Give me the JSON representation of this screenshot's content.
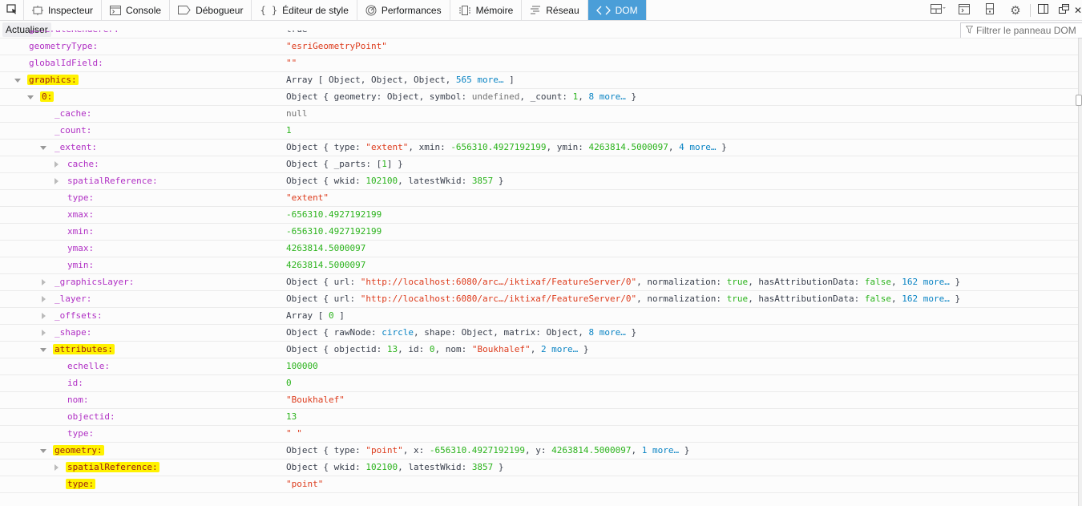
{
  "toolbar": {
    "tabs": [
      {
        "label": "Inspecteur",
        "icon": "inspector-icon",
        "active": false
      },
      {
        "label": "Console",
        "icon": "console-icon",
        "active": false
      },
      {
        "label": "Débogueur",
        "icon": "debugger-icon",
        "active": false
      },
      {
        "label": "Éditeur de style",
        "icon": "style-editor-icon",
        "active": false
      },
      {
        "label": "Performances",
        "icon": "performance-icon",
        "active": false
      },
      {
        "label": "Mémoire",
        "icon": "memory-icon",
        "active": false
      },
      {
        "label": "Réseau",
        "icon": "network-icon",
        "active": false
      },
      {
        "label": "DOM",
        "icon": "dom-icon",
        "active": true
      }
    ],
    "right_icons": [
      "layout-dropdown-icon",
      "split-console-icon",
      "responsive-design-icon",
      "settings-gear-icon",
      "dock-side-icon",
      "undock-window-icon"
    ]
  },
  "subbar": {
    "refresh_label": "Actualiser",
    "filter_placeholder": "Filtrer le panneau DOM"
  },
  "colors": {
    "active_tab": "#4a9ed8",
    "key": "#b02fc4",
    "string": "#dd3b1c",
    "number": "#2bb31c",
    "more_link": "#0a84c4",
    "highlight": "#fff200"
  },
  "tree": {
    "rows": [
      {
        "key": "geometryType:",
        "depth": 1,
        "twisty": "none",
        "highlight": false,
        "value": [
          {
            "t": "\"esriGeometryPoint\"",
            "c": "s"
          }
        ]
      },
      {
        "key": "globalIdField:",
        "depth": 1,
        "twisty": "none",
        "highlight": false,
        "value": [
          {
            "t": "\"\"",
            "c": "s"
          }
        ]
      },
      {
        "key": "graphics:",
        "depth": 1,
        "twisty": "open",
        "highlight": true,
        "value": [
          {
            "t": "Array [ Object, Object, Object, ",
            "c": ""
          },
          {
            "t": "565 more…",
            "c": "m"
          },
          {
            "t": " ]",
            "c": ""
          }
        ]
      },
      {
        "key": "0:",
        "depth": 2,
        "twisty": "open",
        "highlight": true,
        "value": [
          {
            "t": "Object { geometry: Object, symbol: ",
            "c": ""
          },
          {
            "t": "undefined",
            "c": "u"
          },
          {
            "t": ", _count: ",
            "c": ""
          },
          {
            "t": "1",
            "c": "n"
          },
          {
            "t": ", ",
            "c": ""
          },
          {
            "t": "8 more…",
            "c": "m"
          },
          {
            "t": " }",
            "c": ""
          }
        ]
      },
      {
        "key": "_cache:",
        "depth": 3,
        "twisty": "none",
        "highlight": false,
        "value": [
          {
            "t": "null",
            "c": "nul"
          }
        ]
      },
      {
        "key": "_count:",
        "depth": 3,
        "twisty": "none",
        "highlight": false,
        "value": [
          {
            "t": "1",
            "c": "n"
          }
        ]
      },
      {
        "key": "_extent:",
        "depth": 3,
        "twisty": "open",
        "highlight": false,
        "value": [
          {
            "t": "Object { type: ",
            "c": ""
          },
          {
            "t": "\"extent\"",
            "c": "s"
          },
          {
            "t": ", xmin: ",
            "c": ""
          },
          {
            "t": "-656310.4927192199",
            "c": "n"
          },
          {
            "t": ", ymin: ",
            "c": ""
          },
          {
            "t": "4263814.5000097",
            "c": "n"
          },
          {
            "t": ", ",
            "c": ""
          },
          {
            "t": "4 more…",
            "c": "m"
          },
          {
            "t": " }",
            "c": ""
          }
        ]
      },
      {
        "key": "cache:",
        "depth": 4,
        "twisty": "closed",
        "highlight": false,
        "value": [
          {
            "t": "Object { _parts: [",
            "c": ""
          },
          {
            "t": "1",
            "c": "n"
          },
          {
            "t": "] }",
            "c": ""
          }
        ]
      },
      {
        "key": "spatialReference:",
        "depth": 4,
        "twisty": "closed",
        "highlight": false,
        "value": [
          {
            "t": "Object { wkid: ",
            "c": ""
          },
          {
            "t": "102100",
            "c": "n"
          },
          {
            "t": ", latestWkid: ",
            "c": ""
          },
          {
            "t": "3857",
            "c": "n"
          },
          {
            "t": " }",
            "c": ""
          }
        ]
      },
      {
        "key": "type:",
        "depth": 4,
        "twisty": "none",
        "highlight": false,
        "value": [
          {
            "t": "\"extent\"",
            "c": "s"
          }
        ]
      },
      {
        "key": "xmax:",
        "depth": 4,
        "twisty": "none",
        "highlight": false,
        "value": [
          {
            "t": "-656310.4927192199",
            "c": "n"
          }
        ]
      },
      {
        "key": "xmin:",
        "depth": 4,
        "twisty": "none",
        "highlight": false,
        "value": [
          {
            "t": "-656310.4927192199",
            "c": "n"
          }
        ]
      },
      {
        "key": "ymax:",
        "depth": 4,
        "twisty": "none",
        "highlight": false,
        "value": [
          {
            "t": "4263814.5000097",
            "c": "n"
          }
        ]
      },
      {
        "key": "ymin:",
        "depth": 4,
        "twisty": "none",
        "highlight": false,
        "value": [
          {
            "t": "4263814.5000097",
            "c": "n"
          }
        ]
      },
      {
        "key": "_graphicsLayer:",
        "depth": 3,
        "twisty": "closed",
        "highlight": false,
        "value": [
          {
            "t": "Object { url: ",
            "c": ""
          },
          {
            "t": "\"http://localhost:6080/arc…/iktixaf/FeatureServer/0\"",
            "c": "s"
          },
          {
            "t": ", normalization: ",
            "c": ""
          },
          {
            "t": "true",
            "c": "b"
          },
          {
            "t": ", hasAttributionData: ",
            "c": ""
          },
          {
            "t": "false",
            "c": "b"
          },
          {
            "t": ", ",
            "c": ""
          },
          {
            "t": "162 more…",
            "c": "m"
          },
          {
            "t": " }",
            "c": ""
          }
        ]
      },
      {
        "key": "_layer:",
        "depth": 3,
        "twisty": "closed",
        "highlight": false,
        "value": [
          {
            "t": "Object { url: ",
            "c": ""
          },
          {
            "t": "\"http://localhost:6080/arc…/iktixaf/FeatureServer/0\"",
            "c": "s"
          },
          {
            "t": ", normalization: ",
            "c": ""
          },
          {
            "t": "true",
            "c": "b"
          },
          {
            "t": ", hasAttributionData: ",
            "c": ""
          },
          {
            "t": "false",
            "c": "b"
          },
          {
            "t": ", ",
            "c": ""
          },
          {
            "t": "162 more…",
            "c": "m"
          },
          {
            "t": " }",
            "c": ""
          }
        ]
      },
      {
        "key": "_offsets:",
        "depth": 3,
        "twisty": "closed",
        "highlight": false,
        "value": [
          {
            "t": "Array [ ",
            "c": ""
          },
          {
            "t": "0",
            "c": "n"
          },
          {
            "t": " ]",
            "c": ""
          }
        ]
      },
      {
        "key": "_shape:",
        "depth": 3,
        "twisty": "closed",
        "highlight": false,
        "value": [
          {
            "t": "Object { rawNode: ",
            "c": ""
          },
          {
            "t": "circle",
            "c": "nd"
          },
          {
            "t": ", shape: Object, matrix: Object, ",
            "c": ""
          },
          {
            "t": "8 more…",
            "c": "m"
          },
          {
            "t": " }",
            "c": ""
          }
        ]
      },
      {
        "key": "attributes:",
        "depth": 3,
        "twisty": "open",
        "highlight": true,
        "value": [
          {
            "t": "Object { objectid: ",
            "c": ""
          },
          {
            "t": "13",
            "c": "n"
          },
          {
            "t": ", id: ",
            "c": ""
          },
          {
            "t": "0",
            "c": "n"
          },
          {
            "t": ", nom: ",
            "c": ""
          },
          {
            "t": "\"Boukhalef\"",
            "c": "s"
          },
          {
            "t": ", ",
            "c": ""
          },
          {
            "t": "2 more…",
            "c": "m"
          },
          {
            "t": " }",
            "c": ""
          }
        ]
      },
      {
        "key": "echelle:",
        "depth": 4,
        "twisty": "none",
        "highlight": false,
        "value": [
          {
            "t": "100000",
            "c": "n"
          }
        ]
      },
      {
        "key": "id:",
        "depth": 4,
        "twisty": "none",
        "highlight": false,
        "value": [
          {
            "t": "0",
            "c": "n"
          }
        ]
      },
      {
        "key": "nom:",
        "depth": 4,
        "twisty": "none",
        "highlight": false,
        "value": [
          {
            "t": "\"Boukhalef\"",
            "c": "s"
          }
        ]
      },
      {
        "key": "objectid:",
        "depth": 4,
        "twisty": "none",
        "highlight": false,
        "value": [
          {
            "t": "13",
            "c": "n"
          }
        ]
      },
      {
        "key": "type:",
        "depth": 4,
        "twisty": "none",
        "highlight": false,
        "value": [
          {
            "t": "\" \"",
            "c": "s"
          }
        ]
      },
      {
        "key": "geometry:",
        "depth": 3,
        "twisty": "open",
        "highlight": true,
        "value": [
          {
            "t": "Object { type: ",
            "c": ""
          },
          {
            "t": "\"point\"",
            "c": "s"
          },
          {
            "t": ", x: ",
            "c": ""
          },
          {
            "t": "-656310.4927192199",
            "c": "n"
          },
          {
            "t": ", y: ",
            "c": ""
          },
          {
            "t": "4263814.5000097",
            "c": "n"
          },
          {
            "t": ", ",
            "c": ""
          },
          {
            "t": "1 more…",
            "c": "m"
          },
          {
            "t": " }",
            "c": ""
          }
        ]
      },
      {
        "key": "spatialReference:",
        "depth": 4,
        "twisty": "closed",
        "highlight": true,
        "value": [
          {
            "t": "Object { wkid: ",
            "c": ""
          },
          {
            "t": "102100",
            "c": "n"
          },
          {
            "t": ", latestWkid: ",
            "c": ""
          },
          {
            "t": "3857",
            "c": "n"
          },
          {
            "t": " }",
            "c": ""
          }
        ]
      },
      {
        "key": "type:",
        "depth": 4,
        "twisty": "none",
        "highlight": true,
        "value": [
          {
            "t": "\"point\"",
            "c": "s"
          }
        ]
      }
    ]
  }
}
